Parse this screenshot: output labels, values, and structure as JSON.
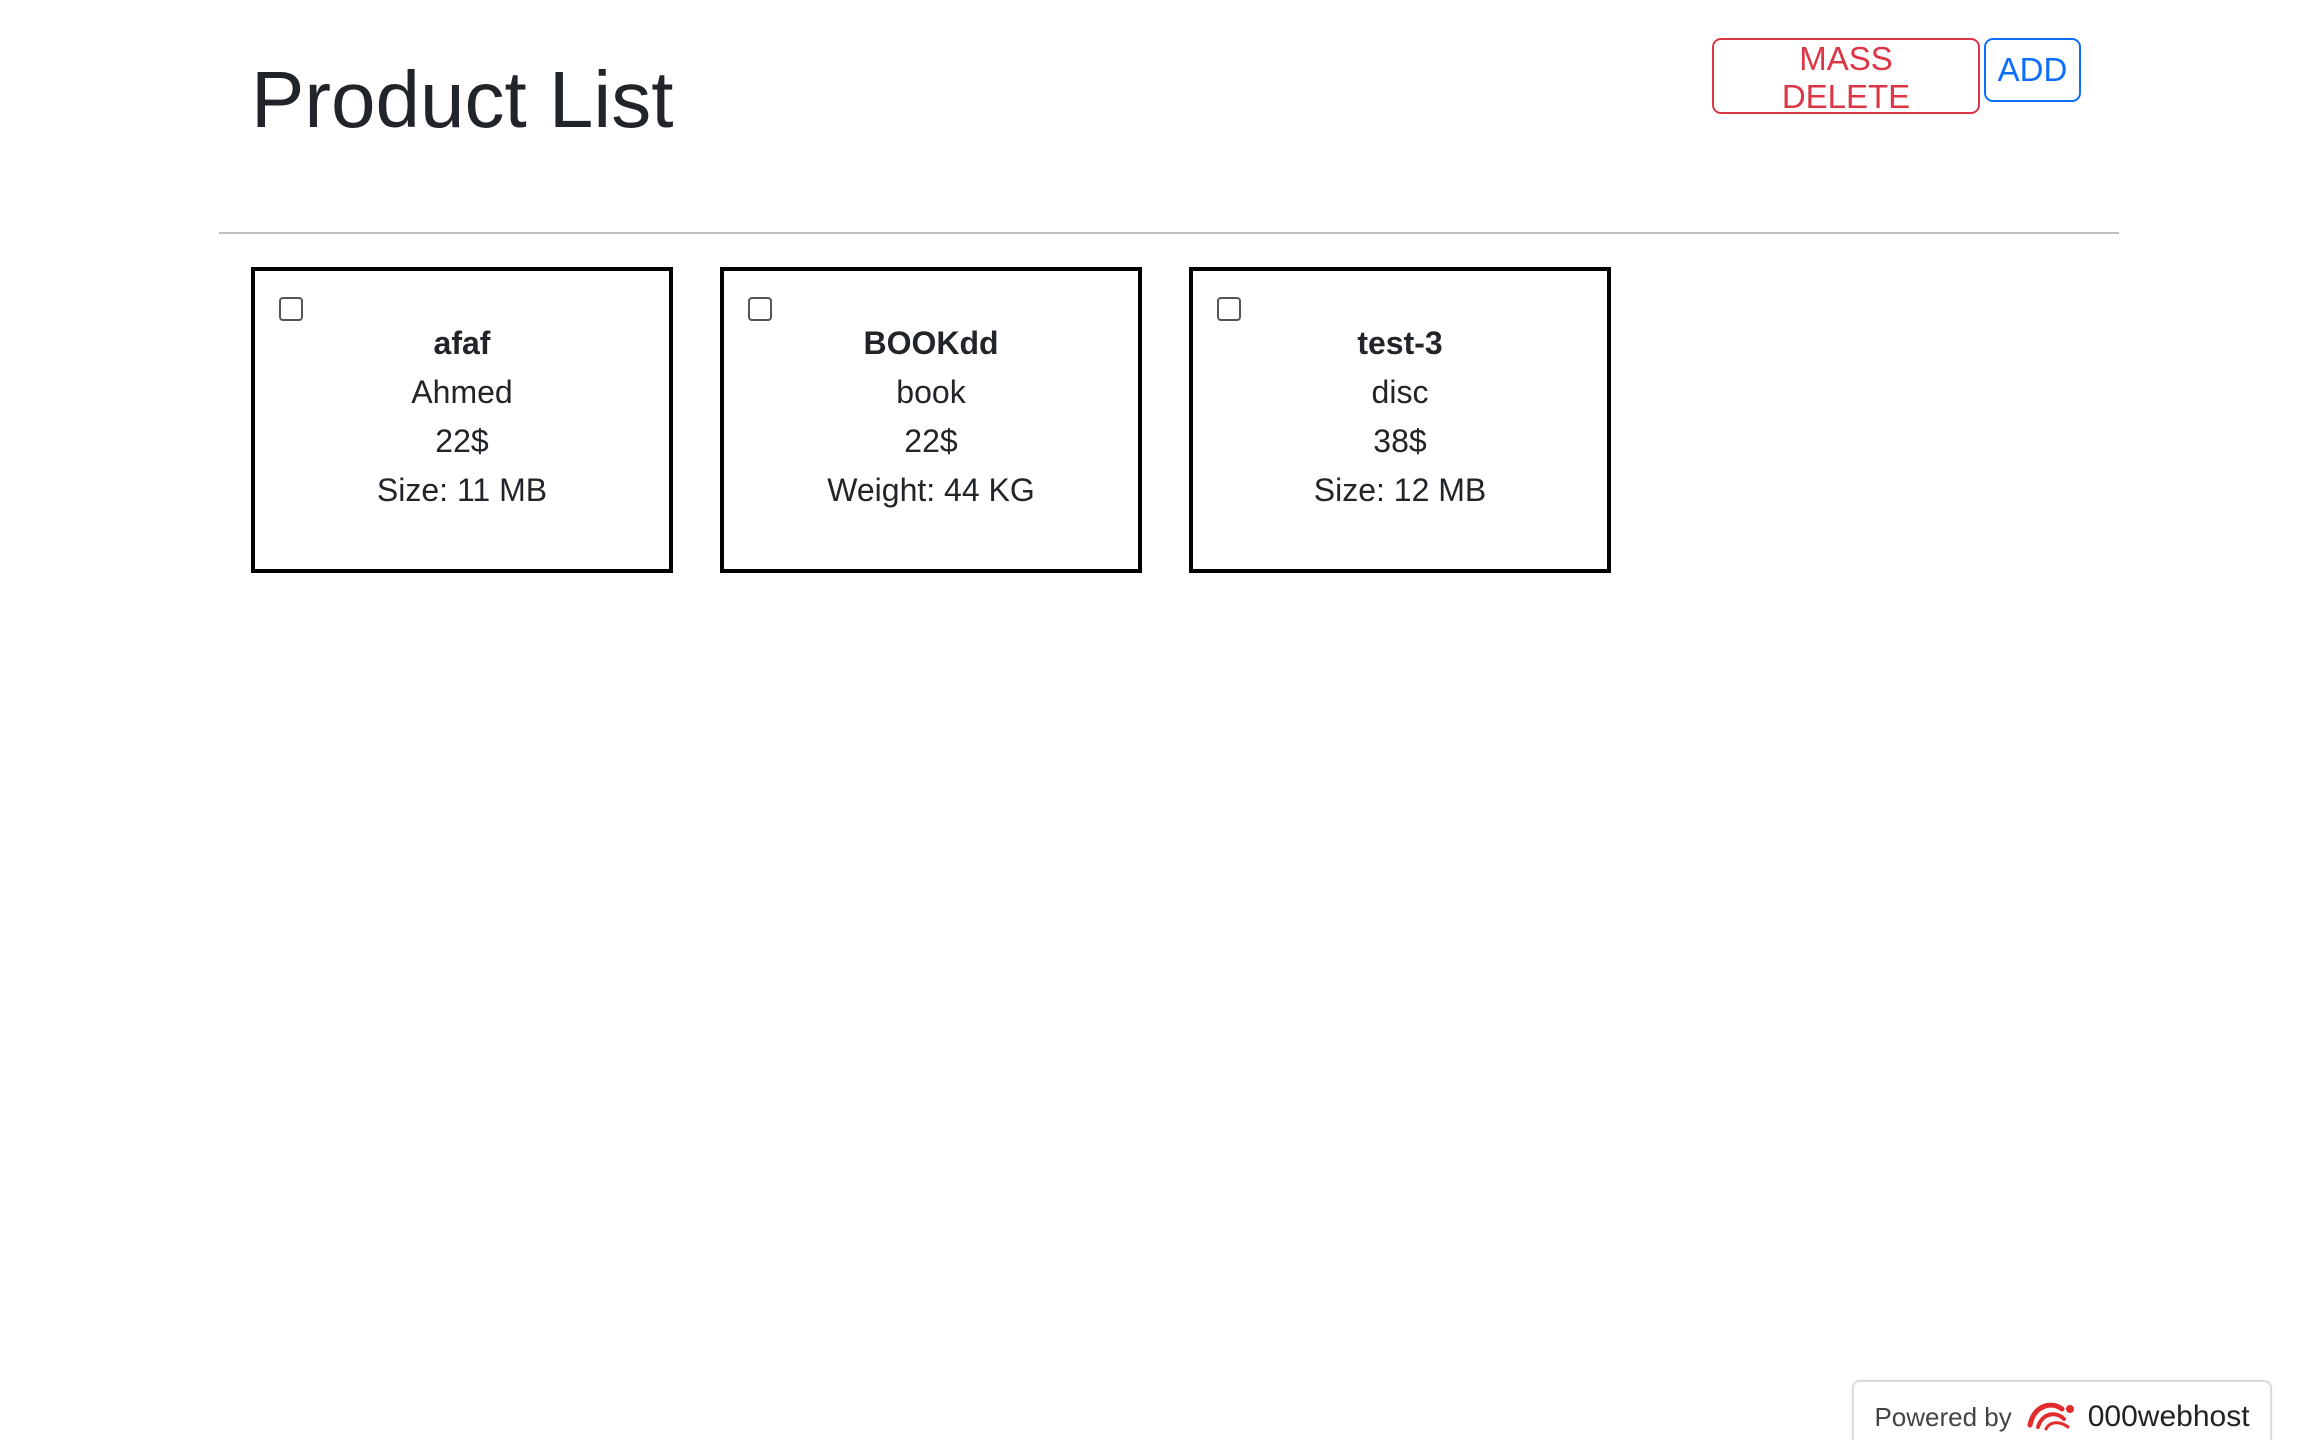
{
  "header": {
    "title": "Product List",
    "mass_delete_label": "MASS DELETE",
    "add_label": "ADD"
  },
  "products": [
    {
      "sku": "afaf",
      "name": "Ahmed",
      "price": "22$",
      "attribute": "Size: 11 MB"
    },
    {
      "sku": "BOOKdd",
      "name": "book",
      "price": "22$",
      "attribute": "Weight: 44 KG"
    },
    {
      "sku": "test-3",
      "name": "disc",
      "price": "38$",
      "attribute": "Size: 12 MB"
    }
  ],
  "footer": {
    "powered_by": "Powered by",
    "host_name": "000webhost",
    "logo_icon": "000webhost-logo-icon"
  },
  "colors": {
    "danger": "#dc3545",
    "primary": "#0d6efd",
    "logo_red": "#e32b2b"
  }
}
